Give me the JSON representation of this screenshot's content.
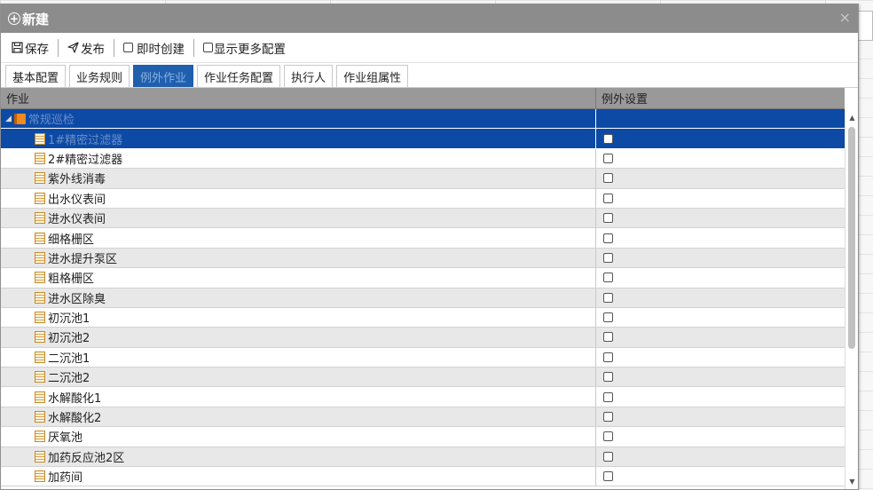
{
  "dialog": {
    "title": "新建",
    "close_glyph": "×"
  },
  "toolbar": {
    "save_label": "保存",
    "publish_label": "发布",
    "instant_create_label": "即时创建",
    "show_more_label": "显示更多配置"
  },
  "tabs": [
    {
      "label": "基本配置",
      "active": false
    },
    {
      "label": "业务规则",
      "active": false
    },
    {
      "label": "例外作业",
      "active": true
    },
    {
      "label": "作业任务配置",
      "active": false
    },
    {
      "label": "执行人",
      "active": false
    },
    {
      "label": "作业组属性",
      "active": false
    }
  ],
  "grid": {
    "col_task": "作业",
    "col_exception": "例外设置",
    "rows": [
      {
        "label": "常规巡检",
        "type": "group",
        "selected": true
      },
      {
        "label": "1#精密过滤器",
        "type": "leaf",
        "selected": true
      },
      {
        "label": "2#精密过滤器",
        "type": "leaf"
      },
      {
        "label": "紫外线消毒",
        "type": "leaf"
      },
      {
        "label": "出水仪表间",
        "type": "leaf"
      },
      {
        "label": "进水仪表间",
        "type": "leaf"
      },
      {
        "label": "细格栅区",
        "type": "leaf"
      },
      {
        "label": "进水提升泵区",
        "type": "leaf"
      },
      {
        "label": "粗格栅区",
        "type": "leaf"
      },
      {
        "label": "进水区除臭",
        "type": "leaf"
      },
      {
        "label": "初沉池1",
        "type": "leaf"
      },
      {
        "label": "初沉池2",
        "type": "leaf"
      },
      {
        "label": "二沉池1",
        "type": "leaf"
      },
      {
        "label": "二沉池2",
        "type": "leaf"
      },
      {
        "label": "水解酸化1",
        "type": "leaf"
      },
      {
        "label": "水解酸化2",
        "type": "leaf"
      },
      {
        "label": "厌氧池",
        "type": "leaf"
      },
      {
        "label": "加药反应池2区",
        "type": "leaf"
      },
      {
        "label": "加药间",
        "type": "leaf"
      }
    ]
  }
}
